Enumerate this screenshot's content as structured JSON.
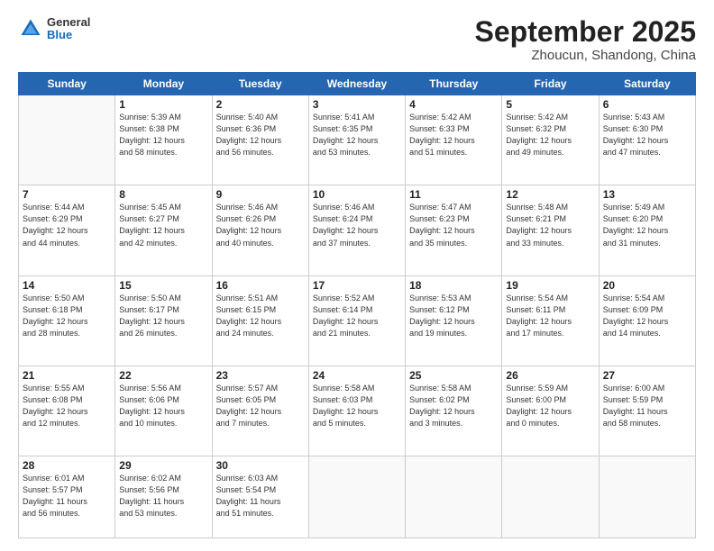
{
  "header": {
    "logo_general": "General",
    "logo_blue": "Blue",
    "month_title": "September 2025",
    "subtitle": "Zhoucun, Shandong, China"
  },
  "days_of_week": [
    "Sunday",
    "Monday",
    "Tuesday",
    "Wednesday",
    "Thursday",
    "Friday",
    "Saturday"
  ],
  "weeks": [
    [
      {
        "day": "",
        "info": ""
      },
      {
        "day": "1",
        "info": "Sunrise: 5:39 AM\nSunset: 6:38 PM\nDaylight: 12 hours\nand 58 minutes."
      },
      {
        "day": "2",
        "info": "Sunrise: 5:40 AM\nSunset: 6:36 PM\nDaylight: 12 hours\nand 56 minutes."
      },
      {
        "day": "3",
        "info": "Sunrise: 5:41 AM\nSunset: 6:35 PM\nDaylight: 12 hours\nand 53 minutes."
      },
      {
        "day": "4",
        "info": "Sunrise: 5:42 AM\nSunset: 6:33 PM\nDaylight: 12 hours\nand 51 minutes."
      },
      {
        "day": "5",
        "info": "Sunrise: 5:42 AM\nSunset: 6:32 PM\nDaylight: 12 hours\nand 49 minutes."
      },
      {
        "day": "6",
        "info": "Sunrise: 5:43 AM\nSunset: 6:30 PM\nDaylight: 12 hours\nand 47 minutes."
      }
    ],
    [
      {
        "day": "7",
        "info": "Sunrise: 5:44 AM\nSunset: 6:29 PM\nDaylight: 12 hours\nand 44 minutes."
      },
      {
        "day": "8",
        "info": "Sunrise: 5:45 AM\nSunset: 6:27 PM\nDaylight: 12 hours\nand 42 minutes."
      },
      {
        "day": "9",
        "info": "Sunrise: 5:46 AM\nSunset: 6:26 PM\nDaylight: 12 hours\nand 40 minutes."
      },
      {
        "day": "10",
        "info": "Sunrise: 5:46 AM\nSunset: 6:24 PM\nDaylight: 12 hours\nand 37 minutes."
      },
      {
        "day": "11",
        "info": "Sunrise: 5:47 AM\nSunset: 6:23 PM\nDaylight: 12 hours\nand 35 minutes."
      },
      {
        "day": "12",
        "info": "Sunrise: 5:48 AM\nSunset: 6:21 PM\nDaylight: 12 hours\nand 33 minutes."
      },
      {
        "day": "13",
        "info": "Sunrise: 5:49 AM\nSunset: 6:20 PM\nDaylight: 12 hours\nand 31 minutes."
      }
    ],
    [
      {
        "day": "14",
        "info": "Sunrise: 5:50 AM\nSunset: 6:18 PM\nDaylight: 12 hours\nand 28 minutes."
      },
      {
        "day": "15",
        "info": "Sunrise: 5:50 AM\nSunset: 6:17 PM\nDaylight: 12 hours\nand 26 minutes."
      },
      {
        "day": "16",
        "info": "Sunrise: 5:51 AM\nSunset: 6:15 PM\nDaylight: 12 hours\nand 24 minutes."
      },
      {
        "day": "17",
        "info": "Sunrise: 5:52 AM\nSunset: 6:14 PM\nDaylight: 12 hours\nand 21 minutes."
      },
      {
        "day": "18",
        "info": "Sunrise: 5:53 AM\nSunset: 6:12 PM\nDaylight: 12 hours\nand 19 minutes."
      },
      {
        "day": "19",
        "info": "Sunrise: 5:54 AM\nSunset: 6:11 PM\nDaylight: 12 hours\nand 17 minutes."
      },
      {
        "day": "20",
        "info": "Sunrise: 5:54 AM\nSunset: 6:09 PM\nDaylight: 12 hours\nand 14 minutes."
      }
    ],
    [
      {
        "day": "21",
        "info": "Sunrise: 5:55 AM\nSunset: 6:08 PM\nDaylight: 12 hours\nand 12 minutes."
      },
      {
        "day": "22",
        "info": "Sunrise: 5:56 AM\nSunset: 6:06 PM\nDaylight: 12 hours\nand 10 minutes."
      },
      {
        "day": "23",
        "info": "Sunrise: 5:57 AM\nSunset: 6:05 PM\nDaylight: 12 hours\nand 7 minutes."
      },
      {
        "day": "24",
        "info": "Sunrise: 5:58 AM\nSunset: 6:03 PM\nDaylight: 12 hours\nand 5 minutes."
      },
      {
        "day": "25",
        "info": "Sunrise: 5:58 AM\nSunset: 6:02 PM\nDaylight: 12 hours\nand 3 minutes."
      },
      {
        "day": "26",
        "info": "Sunrise: 5:59 AM\nSunset: 6:00 PM\nDaylight: 12 hours\nand 0 minutes."
      },
      {
        "day": "27",
        "info": "Sunrise: 6:00 AM\nSunset: 5:59 PM\nDaylight: 11 hours\nand 58 minutes."
      }
    ],
    [
      {
        "day": "28",
        "info": "Sunrise: 6:01 AM\nSunset: 5:57 PM\nDaylight: 11 hours\nand 56 minutes."
      },
      {
        "day": "29",
        "info": "Sunrise: 6:02 AM\nSunset: 5:56 PM\nDaylight: 11 hours\nand 53 minutes."
      },
      {
        "day": "30",
        "info": "Sunrise: 6:03 AM\nSunset: 5:54 PM\nDaylight: 11 hours\nand 51 minutes."
      },
      {
        "day": "",
        "info": ""
      },
      {
        "day": "",
        "info": ""
      },
      {
        "day": "",
        "info": ""
      },
      {
        "day": "",
        "info": ""
      }
    ]
  ]
}
